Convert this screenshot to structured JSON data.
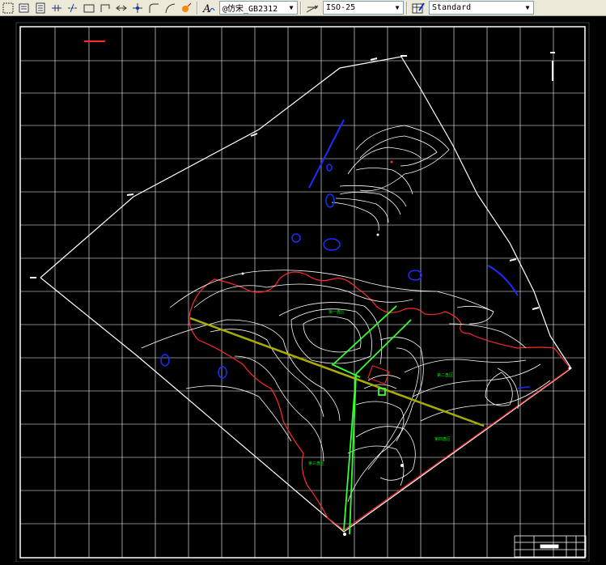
{
  "toolbar": {
    "text_style": "@仿宋_GB2312",
    "dim_style": "ISO-25",
    "table_style": "Standard"
  },
  "drawing": {
    "labels": [
      "第一盘区",
      "第二盘区",
      "第三盘区",
      "第四盘区"
    ]
  },
  "colors": {
    "background": "#000000",
    "grid": "#ffffff",
    "boundary": "#ff2a2a",
    "contour": "#ffffff",
    "water": "#1c2cff",
    "survey_line": "#33ff33",
    "section_line": "#c8a000",
    "label": "#00e000"
  },
  "icons": [
    "select-icon",
    "layer-icon",
    "dimension-icon",
    "line-icon",
    "rect-icon",
    "polyline-icon",
    "move-icon",
    "arc-icon",
    "explode-icon",
    "text-style-icon",
    "dim-style-icon",
    "table-style-icon"
  ]
}
